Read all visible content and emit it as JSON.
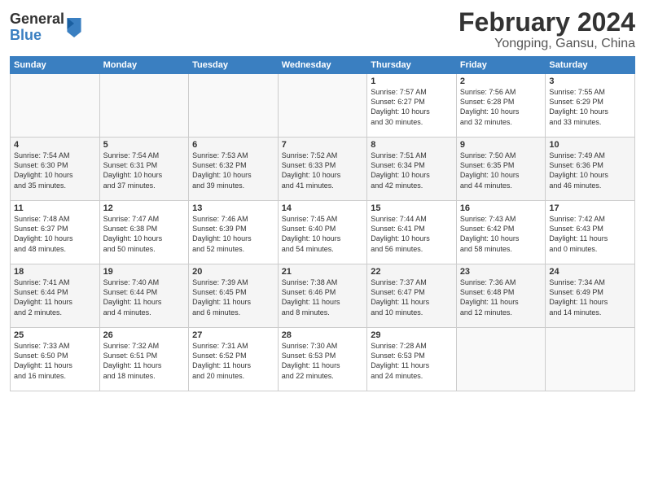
{
  "header": {
    "logo_line1": "General",
    "logo_line2": "Blue",
    "month": "February 2024",
    "location": "Yongping, Gansu, China"
  },
  "weekdays": [
    "Sunday",
    "Monday",
    "Tuesday",
    "Wednesday",
    "Thursday",
    "Friday",
    "Saturday"
  ],
  "weeks": [
    [
      {
        "day": "",
        "info": ""
      },
      {
        "day": "",
        "info": ""
      },
      {
        "day": "",
        "info": ""
      },
      {
        "day": "",
        "info": ""
      },
      {
        "day": "1",
        "info": "Sunrise: 7:57 AM\nSunset: 6:27 PM\nDaylight: 10 hours\nand 30 minutes."
      },
      {
        "day": "2",
        "info": "Sunrise: 7:56 AM\nSunset: 6:28 PM\nDaylight: 10 hours\nand 32 minutes."
      },
      {
        "day": "3",
        "info": "Sunrise: 7:55 AM\nSunset: 6:29 PM\nDaylight: 10 hours\nand 33 minutes."
      }
    ],
    [
      {
        "day": "4",
        "info": "Sunrise: 7:54 AM\nSunset: 6:30 PM\nDaylight: 10 hours\nand 35 minutes."
      },
      {
        "day": "5",
        "info": "Sunrise: 7:54 AM\nSunset: 6:31 PM\nDaylight: 10 hours\nand 37 minutes."
      },
      {
        "day": "6",
        "info": "Sunrise: 7:53 AM\nSunset: 6:32 PM\nDaylight: 10 hours\nand 39 minutes."
      },
      {
        "day": "7",
        "info": "Sunrise: 7:52 AM\nSunset: 6:33 PM\nDaylight: 10 hours\nand 41 minutes."
      },
      {
        "day": "8",
        "info": "Sunrise: 7:51 AM\nSunset: 6:34 PM\nDaylight: 10 hours\nand 42 minutes."
      },
      {
        "day": "9",
        "info": "Sunrise: 7:50 AM\nSunset: 6:35 PM\nDaylight: 10 hours\nand 44 minutes."
      },
      {
        "day": "10",
        "info": "Sunrise: 7:49 AM\nSunset: 6:36 PM\nDaylight: 10 hours\nand 46 minutes."
      }
    ],
    [
      {
        "day": "11",
        "info": "Sunrise: 7:48 AM\nSunset: 6:37 PM\nDaylight: 10 hours\nand 48 minutes."
      },
      {
        "day": "12",
        "info": "Sunrise: 7:47 AM\nSunset: 6:38 PM\nDaylight: 10 hours\nand 50 minutes."
      },
      {
        "day": "13",
        "info": "Sunrise: 7:46 AM\nSunset: 6:39 PM\nDaylight: 10 hours\nand 52 minutes."
      },
      {
        "day": "14",
        "info": "Sunrise: 7:45 AM\nSunset: 6:40 PM\nDaylight: 10 hours\nand 54 minutes."
      },
      {
        "day": "15",
        "info": "Sunrise: 7:44 AM\nSunset: 6:41 PM\nDaylight: 10 hours\nand 56 minutes."
      },
      {
        "day": "16",
        "info": "Sunrise: 7:43 AM\nSunset: 6:42 PM\nDaylight: 10 hours\nand 58 minutes."
      },
      {
        "day": "17",
        "info": "Sunrise: 7:42 AM\nSunset: 6:43 PM\nDaylight: 11 hours\nand 0 minutes."
      }
    ],
    [
      {
        "day": "18",
        "info": "Sunrise: 7:41 AM\nSunset: 6:44 PM\nDaylight: 11 hours\nand 2 minutes."
      },
      {
        "day": "19",
        "info": "Sunrise: 7:40 AM\nSunset: 6:44 PM\nDaylight: 11 hours\nand 4 minutes."
      },
      {
        "day": "20",
        "info": "Sunrise: 7:39 AM\nSunset: 6:45 PM\nDaylight: 11 hours\nand 6 minutes."
      },
      {
        "day": "21",
        "info": "Sunrise: 7:38 AM\nSunset: 6:46 PM\nDaylight: 11 hours\nand 8 minutes."
      },
      {
        "day": "22",
        "info": "Sunrise: 7:37 AM\nSunset: 6:47 PM\nDaylight: 11 hours\nand 10 minutes."
      },
      {
        "day": "23",
        "info": "Sunrise: 7:36 AM\nSunset: 6:48 PM\nDaylight: 11 hours\nand 12 minutes."
      },
      {
        "day": "24",
        "info": "Sunrise: 7:34 AM\nSunset: 6:49 PM\nDaylight: 11 hours\nand 14 minutes."
      }
    ],
    [
      {
        "day": "25",
        "info": "Sunrise: 7:33 AM\nSunset: 6:50 PM\nDaylight: 11 hours\nand 16 minutes."
      },
      {
        "day": "26",
        "info": "Sunrise: 7:32 AM\nSunset: 6:51 PM\nDaylight: 11 hours\nand 18 minutes."
      },
      {
        "day": "27",
        "info": "Sunrise: 7:31 AM\nSunset: 6:52 PM\nDaylight: 11 hours\nand 20 minutes."
      },
      {
        "day": "28",
        "info": "Sunrise: 7:30 AM\nSunset: 6:53 PM\nDaylight: 11 hours\nand 22 minutes."
      },
      {
        "day": "29",
        "info": "Sunrise: 7:28 AM\nSunset: 6:53 PM\nDaylight: 11 hours\nand 24 minutes."
      },
      {
        "day": "",
        "info": ""
      },
      {
        "day": "",
        "info": ""
      }
    ]
  ]
}
